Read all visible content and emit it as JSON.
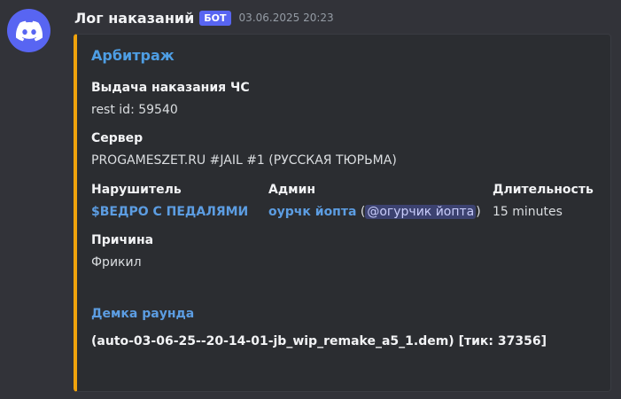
{
  "message": {
    "username": "Лог наказаний",
    "bot_tag": "БОТ",
    "timestamp": "03.06.2025 20:23"
  },
  "embed": {
    "accent_color": "#f0a30c",
    "author": "Арбитраж",
    "fields": {
      "punishment": {
        "name": "Выдача наказания ЧС",
        "value": "rest id: 59540"
      },
      "server": {
        "name": "Сервер",
        "value": "PROGAMESZET.RU #JAIL #1 (РУССКАЯ ТЮРЬМА)"
      },
      "offender": {
        "name": "Нарушитель",
        "value": "$ВЕДРО С ПЕДАЛЯМИ"
      },
      "admin": {
        "name": "Админ",
        "value": "оурчк йопта",
        "open_paren": "(",
        "mention": "@огурчик йопта",
        "close_paren": ")"
      },
      "duration": {
        "name": "Длительность",
        "value": "15 minutes"
      },
      "reason": {
        "name": "Причина",
        "value": "Фрикил"
      }
    },
    "demo": {
      "title": "Демка раунда",
      "file": "(auto-03-06-25--20-14-01-jb_wip_remake_a5_1.dem) [тик: 37356]"
    }
  }
}
